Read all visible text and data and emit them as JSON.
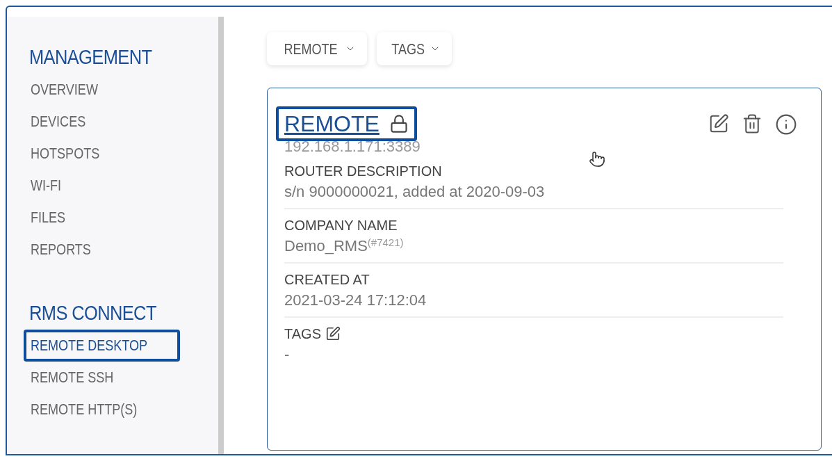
{
  "sidebar": {
    "sections": [
      {
        "title": "MANAGEMENT",
        "items": [
          {
            "label": "OVERVIEW",
            "selected": false
          },
          {
            "label": "DEVICES",
            "selected": false
          },
          {
            "label": "HOTSPOTS",
            "selected": false
          },
          {
            "label": "WI-FI",
            "selected": false
          },
          {
            "label": "FILES",
            "selected": false
          },
          {
            "label": "REPORTS",
            "selected": false
          }
        ]
      },
      {
        "title": "RMS CONNECT",
        "items": [
          {
            "label": "REMOTE DESKTOP",
            "selected": true
          },
          {
            "label": "REMOTE SSH",
            "selected": false
          },
          {
            "label": "REMOTE HTTP(S)",
            "selected": false
          }
        ]
      }
    ]
  },
  "filters": [
    {
      "label": "REMOTE"
    },
    {
      "label": "TAGS"
    }
  ],
  "card": {
    "title": "REMOTE",
    "highlighted": true,
    "locked": true,
    "address": "192.168.1.171:3389",
    "fields": [
      {
        "label": "ROUTER DESCRIPTION",
        "value": "s/n 9000000021, added at 2020-09-03",
        "editable": false
      },
      {
        "label": "COMPANY NAME",
        "value": "Demo_RMS$^{(#7421)}$",
        "editable": false
      },
      {
        "label": "CREATED AT",
        "value": "2021-03-24 17:12:04",
        "editable": false
      },
      {
        "label": "TAGS",
        "value": "-",
        "editable": true
      }
    ]
  }
}
